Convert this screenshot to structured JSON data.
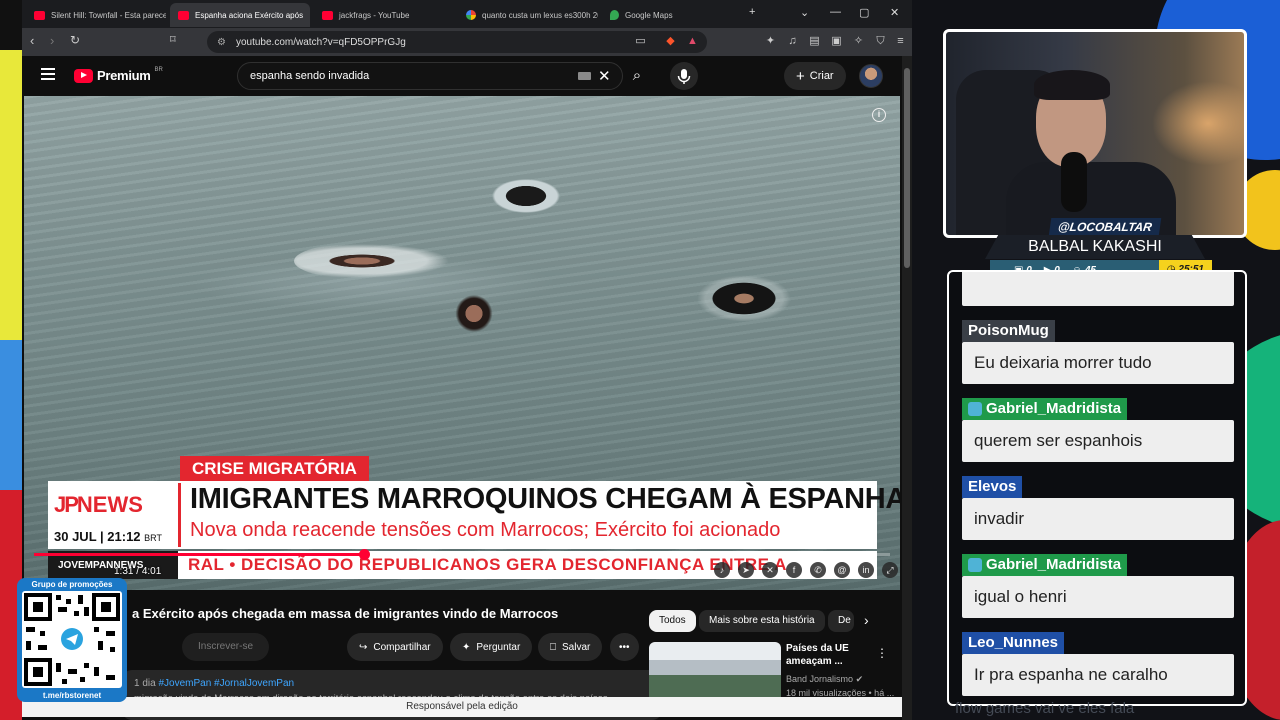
{
  "browser": {
    "tabs": [
      {
        "title": "Silent Hill: Townfall - Esta parecendo",
        "active": false,
        "favicon": "youtube-icon"
      },
      {
        "title": "Espanha aciona Exército após",
        "active": true,
        "favicon": "youtube-icon"
      },
      {
        "title": "jackfrags - YouTube",
        "active": false,
        "favicon": "youtube-icon"
      },
      {
        "title": "quanto custa um lexus es300h 2020",
        "active": false,
        "favicon": "google-icon"
      },
      {
        "title": "Google Maps",
        "active": false,
        "favicon": "maps-icon"
      }
    ],
    "url": "youtube.com/watch?v=qFD5OPPrGJg",
    "brave_badge_count": "80"
  },
  "youtube": {
    "logo_text": "Premium",
    "region": "BR",
    "search_value": "espanha sendo invadida",
    "create_label": "Criar",
    "video": {
      "category_tag": "CRISE MIGRATÓRIA",
      "logo_jp": "JP",
      "logo_news": "NEWS",
      "headline": "IMIGRANTES MARROQUINOS CHEGAM À ESPANHA",
      "subheadline": "Nova onda reacende tensões com Marrocos; Exército foi acionado",
      "date": "30 JUL",
      "clock": "21:12",
      "timezone": "BRT",
      "ticker_brand": "JOVEMPANNEWS",
      "ticker_text": "RAL • DECISÃO DO REPUBLICANOS GERA DESCONFIANÇA ENTRE A",
      "current_time": "1:31",
      "duration": "4:01",
      "progress": 0.386
    },
    "title": "a Exército após chegada em massa de imigrantes vindo de Marrocos",
    "subscribe_label": "Inscrever-se",
    "share_label": "Compartilhar",
    "ask_label": "Perguntar",
    "save_label": "Salvar",
    "description": {
      "age": "1 dia",
      "hashtags": "#JovemPan #JornalJovemPan",
      "text": "migração vinda do Marrocos em direção ao território espanhol reacendeu o clima de tensão entre os dois países"
    },
    "chips": [
      "Todos",
      "Mais sobre esta história",
      "De"
    ],
    "recommendation": {
      "title": "Países da UE ameaçam ...",
      "channel": "Band Jornalismo",
      "views": "18 mil visualizações • há ..."
    },
    "footer": "Responsável pela edição"
  },
  "qr": {
    "title": "Grupo de promoções",
    "url": "t.me/rbstorenet"
  },
  "stream": {
    "handle": "@LOCOBALTAR",
    "name": "BALBAL KAKASHI",
    "stat1": "0",
    "stat2": "0",
    "stat3": "45",
    "timer": "25:51"
  },
  "chat": {
    "messages": [
      {
        "user": "PoisonMug",
        "text": "Eu deixaria morrer tudo",
        "color": "#3a3f47",
        "badge": false
      },
      {
        "user": "Gabriel_Madridista",
        "text": "querem ser espanhois",
        "color": "#1f9a4a",
        "badge": true
      },
      {
        "user": "Elevos",
        "text": "invadir",
        "color": "#1f4fa6",
        "badge": false
      },
      {
        "user": "Gabriel_Madridista",
        "text": "igual o henri",
        "color": "#1f9a4a",
        "badge": true
      },
      {
        "user": "Leo_Nunnes",
        "text": "Ir pra espanha ne caralho",
        "color": "#1f4fa6",
        "badge": false
      }
    ],
    "tail": "flow games vai ve eles fala"
  }
}
